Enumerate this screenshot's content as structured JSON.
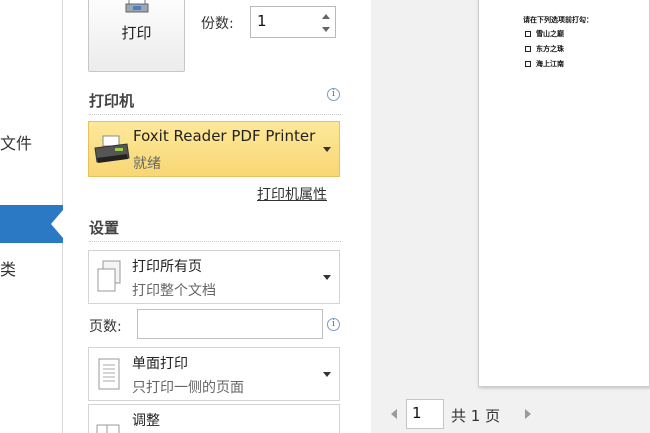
{
  "nav": {
    "file_label": "文件",
    "misc_label": "类"
  },
  "print": {
    "button_label": "打印",
    "copies_label": "份数:",
    "copies_value": "1"
  },
  "printer": {
    "section_title": "打印机",
    "name": "Foxit Reader PDF Printer",
    "status": "就绪",
    "properties_link": "打印机属性"
  },
  "settings": {
    "section_title": "设置",
    "range_title": "打印所有页",
    "range_desc": "打印整个文档",
    "pages_label": "页数:",
    "pages_value": "",
    "sides_title": "单面打印",
    "sides_desc": "只打印一侧的页面",
    "collate_title": "调整"
  },
  "preview": {
    "question": "请在下列选项前打勾：",
    "options": [
      "雪山之巅",
      "东方之珠",
      "海上江南"
    ],
    "current_page": "1",
    "total_pages": "共 1 页"
  },
  "icons": {
    "info": "info-icon",
    "printer": "printer-icon",
    "pages": "pages-icon",
    "single_side": "single-side-icon"
  },
  "colors": {
    "active_nav": "#2b78c5",
    "printer_highlight": "#f8d774"
  }
}
